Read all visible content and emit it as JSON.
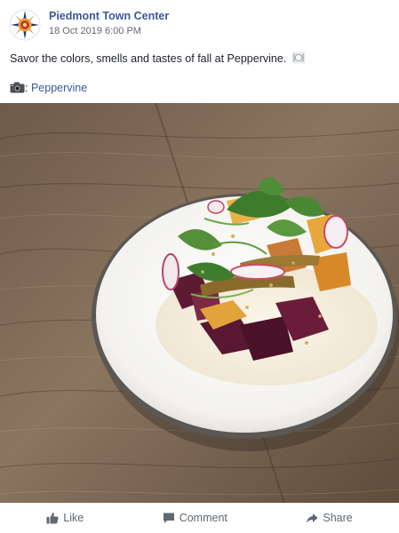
{
  "post": {
    "page_name": "Piedmont Town Center",
    "timestamp": "18 Oct 2019 6:00 PM",
    "caption": "Savor the colors, smells and tastes of fall at Peppervine.",
    "caption_emoji": "plate-with-cutlery-icon",
    "credit_separator": ":",
    "credit_link": "Peppervine",
    "credit_icon": "camera-icon",
    "photo_description_icon": "food-photo"
  },
  "actions": {
    "like_label": "Like",
    "comment_label": "Comment",
    "share_label": "Share"
  },
  "colors": {
    "page_name": "#3b5998",
    "link": "#385898",
    "muted": "#616770",
    "action_text": "#606770"
  }
}
